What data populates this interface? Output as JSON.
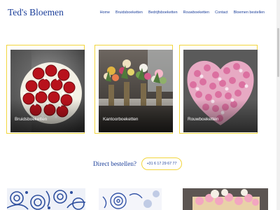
{
  "site": {
    "title": "Ted's Bloemen"
  },
  "nav": {
    "items": [
      {
        "label": "Home"
      },
      {
        "label": "Bruidsboeketten"
      },
      {
        "label": "Bedrijfsboeketten"
      },
      {
        "label": "Rouwboeketten"
      },
      {
        "label": "Contact"
      },
      {
        "label": "Bloemen bestellen"
      }
    ]
  },
  "cards": [
    {
      "caption": "Bruidsboeketten"
    },
    {
      "caption": "Kantoorboeketten"
    },
    {
      "caption": "Rouwboeketten"
    }
  ],
  "order": {
    "label": "Direct bestellen?",
    "phone": "+31 6 17 29 67 77"
  },
  "colors": {
    "brand": "#1c3f9a",
    "accent": "#f2d53c"
  }
}
